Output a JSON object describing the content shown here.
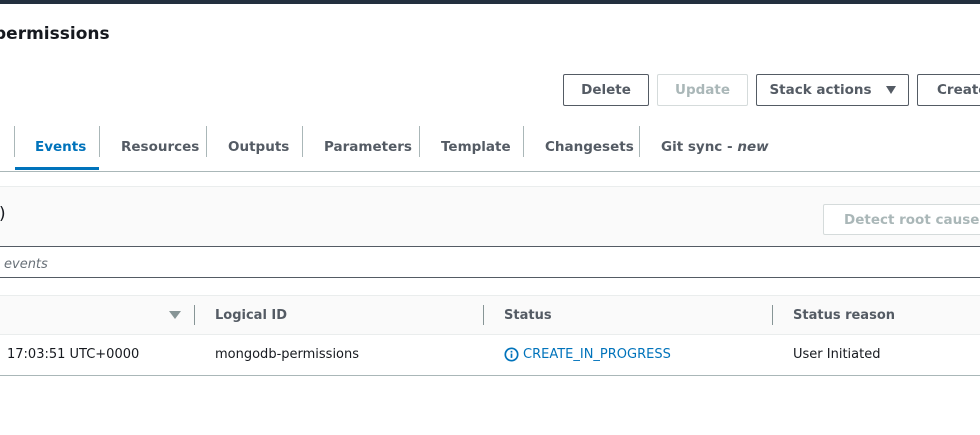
{
  "header": {
    "title": "permissions"
  },
  "toolbar": {
    "delete_label": "Delete",
    "update_label": "Update",
    "stack_actions_label": "Stack actions",
    "create_label": "Create"
  },
  "tabs": [
    {
      "label": "Events",
      "active": true
    },
    {
      "label": "Resources"
    },
    {
      "label": "Outputs"
    },
    {
      "label": "Parameters"
    },
    {
      "label": "Template"
    },
    {
      "label": "Changesets"
    },
    {
      "label": "Git sync - ",
      "suffix": "new"
    }
  ],
  "events_panel": {
    "title_fragment": ")",
    "detect_label": "Detect root cause",
    "search_placeholder": "events"
  },
  "table": {
    "columns": [
      "Logical ID",
      "Status",
      "Status reason"
    ],
    "rows": [
      {
        "timestamp": "17:03:51 UTC+0000",
        "logical_id": "mongodb-permissions",
        "status": "CREATE_IN_PROGRESS",
        "status_reason": "User Initiated"
      }
    ]
  },
  "colors": {
    "accent": "#0073bb",
    "topbar": "#232f3e",
    "text": "#16191f",
    "muted": "#545b64"
  },
  "icons": {
    "status": "info-circle-icon",
    "sort": "caret-down-icon",
    "dropdown": "caret-down-icon"
  }
}
